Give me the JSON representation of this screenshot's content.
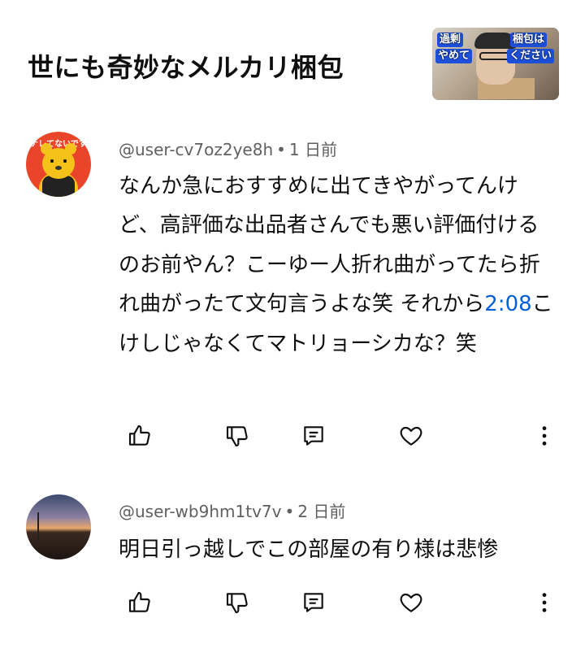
{
  "header": {
    "video_title": "世にも奇妙なメルカリ梱包",
    "thumbnail_captions": [
      "過剰",
      "やめて",
      "梱包は",
      "ください"
    ]
  },
  "comments": [
    {
      "avatar_text": "ナレてないです",
      "author": "@user-cv7oz2ye8h",
      "separator": "•",
      "time": "1 日前",
      "text_before": "なんか急におすすめに出てきやがってんけど、高評価な出品者さんでも悪い評価付けるのお前やん？こーゆー人折れ曲がってたら折れ曲がったて文句言うよな笑 それから",
      "timestamp_link": "2:08",
      "text_after": "こけしじゃなくてマトリョーシカな？笑"
    },
    {
      "author": "@user-wb9hm1tv7v",
      "separator": "•",
      "time": "2 日前",
      "text": "明日引っ越しでこの部屋の有り様は悲惨"
    }
  ],
  "icons": {
    "like": "thumbs-up-icon",
    "dislike": "thumbs-down-icon",
    "reply": "reply-comment-icon",
    "heart": "heart-icon",
    "more": "more-vertical-icon"
  },
  "colors": {
    "text": "#0f0f0f",
    "meta": "#606060",
    "link": "#065fd4",
    "background": "#ffffff"
  }
}
